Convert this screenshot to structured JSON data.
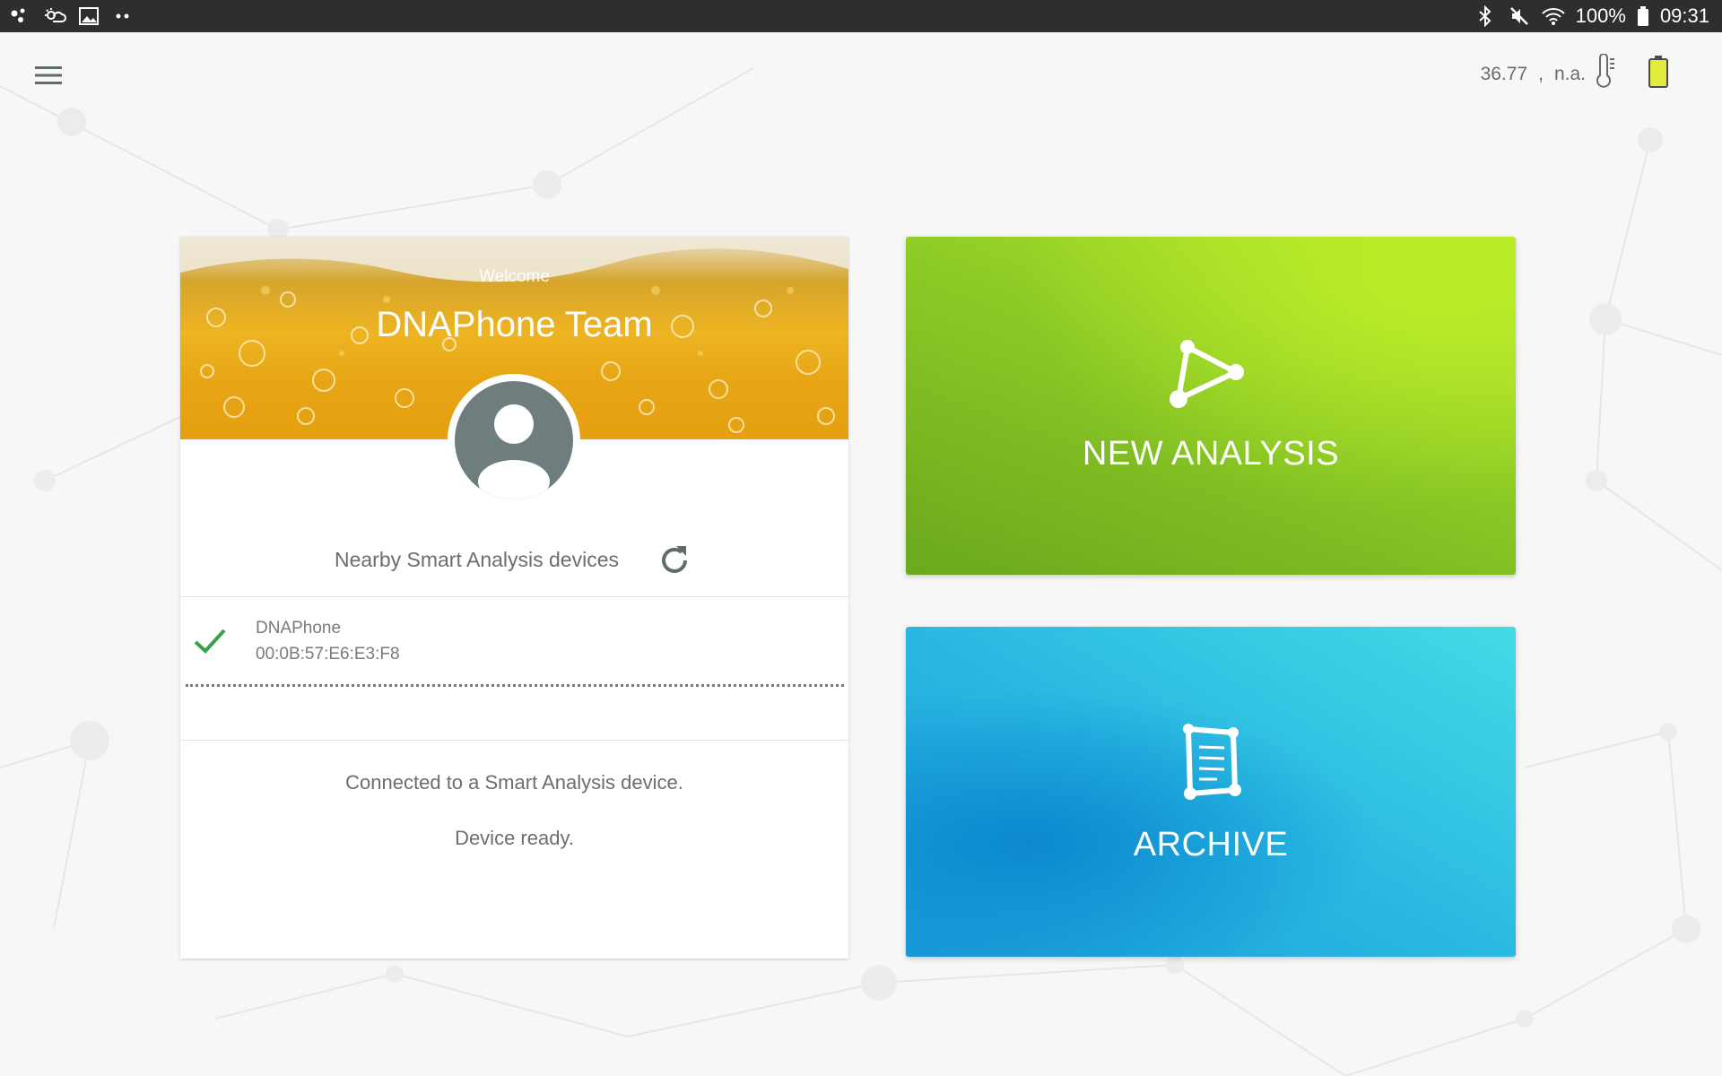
{
  "status_bar": {
    "icons_left": [
      "notification-dots-icon",
      "weather-icon",
      "gallery-icon",
      "more-dots-icon"
    ],
    "icons_right": [
      "bluetooth-icon",
      "mute-icon",
      "wifi-icon"
    ],
    "battery_percent": "100%",
    "time": "09:31"
  },
  "app_bar": {
    "menu_icon": "hamburger-menu-icon",
    "temperature": "36.77",
    "separator": ",",
    "status": "n.a.",
    "thermometer_icon": "thermometer-icon",
    "battery_icon": "battery-icon"
  },
  "profile": {
    "welcome": "Welcome",
    "name": "DNAPhone Team",
    "avatar_icon": "user-avatar-icon"
  },
  "devices": {
    "section_label": "Nearby Smart Analysis devices",
    "refresh_icon": "refresh-icon",
    "items": [
      {
        "name": "DNAPhone",
        "address": "00:0B:57:E6:E3:F8",
        "status_icon": "check-icon"
      }
    ]
  },
  "connection": {
    "message": "Connected to a Smart Analysis device.",
    "ready": "Device ready."
  },
  "tiles": {
    "new_analysis": {
      "label": "NEW ANALYSIS",
      "icon": "triangle-nodes-icon"
    },
    "archive": {
      "label": "ARCHIVE",
      "icon": "document-icon"
    }
  },
  "colors": {
    "new_analysis_accent": "#8cc926",
    "archive_accent": "#2ab9e2",
    "check": "#3aa14b",
    "battery": "#e3ec3c"
  }
}
